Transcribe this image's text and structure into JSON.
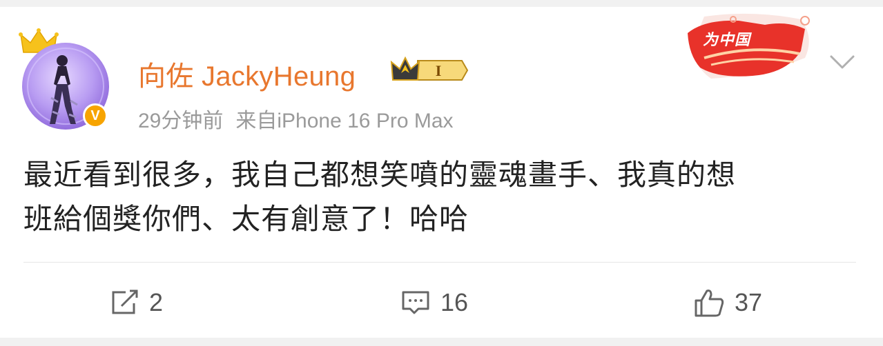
{
  "post": {
    "username": "向佐 JackyHeung",
    "level_badge": "I",
    "time": "29分钟前",
    "source": "来自iPhone 16 Pro Max",
    "banner_text": "为中国",
    "text_line1": "最近看到很多，我自己都想笑噴的靈魂畫手、我真的想",
    "text_line2": "班給個獎你們、太有創意了！哈哈",
    "avatar_verified_mark": "V"
  },
  "actions": {
    "repost_count": "2",
    "comment_count": "16",
    "like_count": "37"
  },
  "colors": {
    "username": "#e8772e",
    "meta": "#9a9a9a",
    "text": "#222222",
    "verified_badge": "#f7a400",
    "banner_red": "#e8322a"
  },
  "icons": [
    "crown-icon",
    "level-crown-icon",
    "chevron-down-icon",
    "repost-icon",
    "comment-icon",
    "like-icon"
  ]
}
